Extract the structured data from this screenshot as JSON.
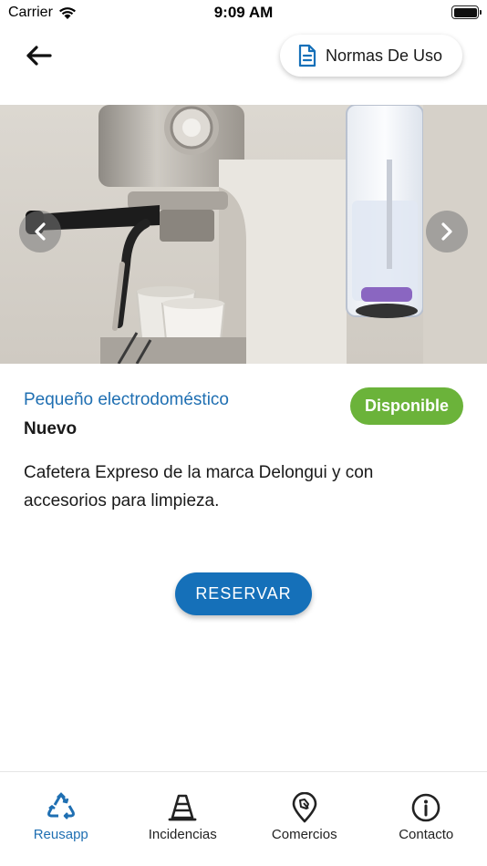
{
  "status_bar": {
    "carrier": "Carrier",
    "time": "9:09 AM"
  },
  "header": {
    "rules_label": "Normas De Uso"
  },
  "item": {
    "category": "Pequeño electrodoméstico",
    "condition": "Nuevo",
    "status": "Disponible",
    "description": "Cafetera Expreso de la marca Delongui y con accesorios para limpieza."
  },
  "actions": {
    "reserve_label": "RESERVAR"
  },
  "tabs": [
    {
      "label": "Reusapp",
      "icon": "recycle-icon",
      "active": true
    },
    {
      "label": "Incidencias",
      "icon": "traffic-cone-icon",
      "active": false
    },
    {
      "label": "Comercios",
      "icon": "location-pin-icon",
      "active": false
    },
    {
      "label": "Contacto",
      "icon": "info-icon",
      "active": false
    }
  ],
  "colors": {
    "accent": "#1570b9",
    "link": "#1f6fb2",
    "status_ok": "#6bb33a"
  }
}
